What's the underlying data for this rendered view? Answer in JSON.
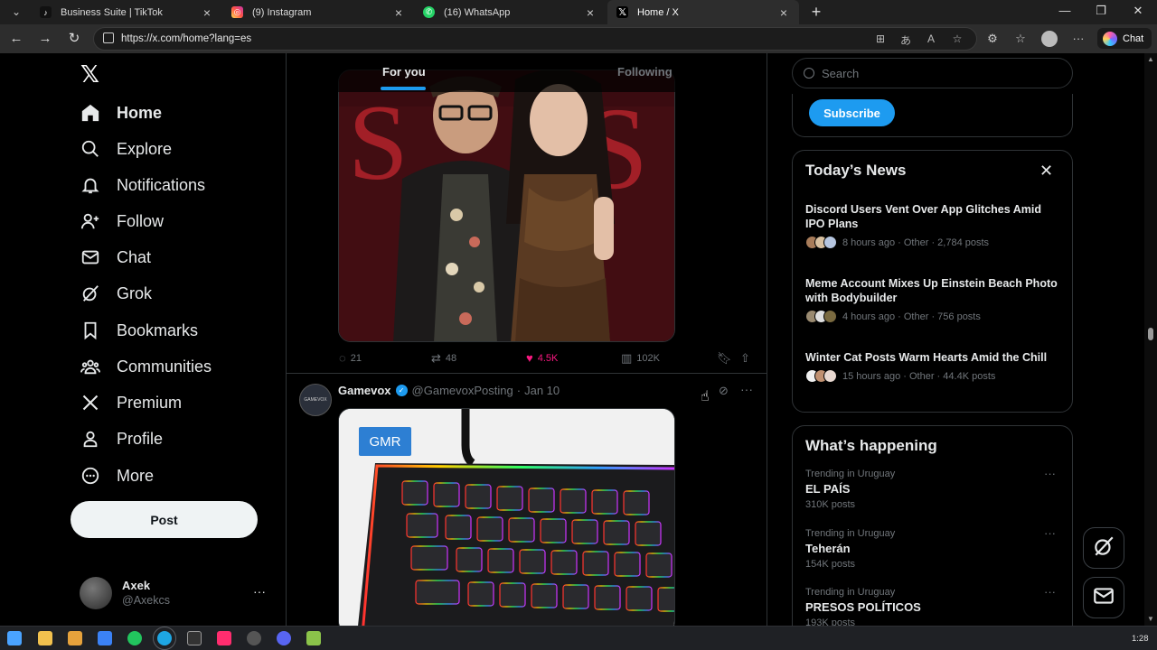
{
  "browser": {
    "tabs": [
      {
        "label": "Business Suite | TikTok",
        "favicon": "tiktok-icon",
        "active": false
      },
      {
        "label": "(9) Instagram",
        "favicon": "instagram-icon",
        "active": false
      },
      {
        "label": "(16) WhatsApp",
        "favicon": "whatsapp-icon",
        "active": false
      },
      {
        "label": "Home / X",
        "favicon": "x-icon",
        "active": true
      }
    ],
    "new_tab": "+",
    "url": "https://x.com/home?lang=es",
    "chat_label": "Chat"
  },
  "nav": {
    "items": [
      {
        "label": "Home",
        "icon": "home-icon"
      },
      {
        "label": "Explore",
        "icon": "search-icon"
      },
      {
        "label": "Notifications",
        "icon": "bell-icon"
      },
      {
        "label": "Follow",
        "icon": "add-person-icon"
      },
      {
        "label": "Chat",
        "icon": "envelope-icon"
      },
      {
        "label": "Grok",
        "icon": "grok-icon"
      },
      {
        "label": "Bookmarks",
        "icon": "bookmark-icon"
      },
      {
        "label": "Communities",
        "icon": "people-icon"
      },
      {
        "label": "Premium",
        "icon": "x-icon"
      },
      {
        "label": "Profile",
        "icon": "person-icon"
      },
      {
        "label": "More",
        "icon": "more-circle-icon"
      }
    ],
    "post_label": "Post",
    "account": {
      "name": "Axek",
      "handle": "@Axekcs",
      "menu": "···"
    }
  },
  "feed": {
    "tabs": {
      "for_you": "For you",
      "following": "Following"
    },
    "tweet1": {
      "replies": "21",
      "retweets": "48",
      "likes": "4.5K",
      "views": "102K"
    },
    "tweet2": {
      "name": "Gamevox",
      "handle": "@GamevoxPosting",
      "sep": "·",
      "date": "Jan 10",
      "avatar_text": "GAMEVOX",
      "media_badge": "GMR"
    }
  },
  "right": {
    "search_placeholder": "Search",
    "subscribe_label": "Subscribe",
    "todays_news": {
      "title": "Today’s News",
      "close": "✕",
      "items": [
        {
          "headline": "Discord Users Vent Over App Glitches Amid IPO Plans",
          "meta": "8 hours ago · Other · 2,784 posts"
        },
        {
          "headline": "Meme Account Mixes Up Einstein Beach Photo with Bodybuilder",
          "meta": "4 hours ago · Other · 756 posts"
        },
        {
          "headline": "Winter Cat Posts Warm Hearts Amid the Chill",
          "meta": "15 hours ago · Other · 44.4K posts"
        }
      ]
    },
    "happening": {
      "title": "What’s happening",
      "trends": [
        {
          "context": "Trending in Uruguay",
          "topic": "EL PAÍS",
          "posts": "310K posts"
        },
        {
          "context": "Trending in Uruguay",
          "topic": "Teherán",
          "posts": "154K posts"
        },
        {
          "context": "Trending in Uruguay",
          "topic": "PRESOS POLÍTICOS",
          "posts": "193K posts"
        }
      ]
    }
  },
  "taskbar": {
    "time": "1:28"
  },
  "colors": {
    "accent": "#1d9bf0",
    "like": "#f91880",
    "background": "#000000",
    "border": "#2f3336",
    "muted": "#71767b"
  }
}
